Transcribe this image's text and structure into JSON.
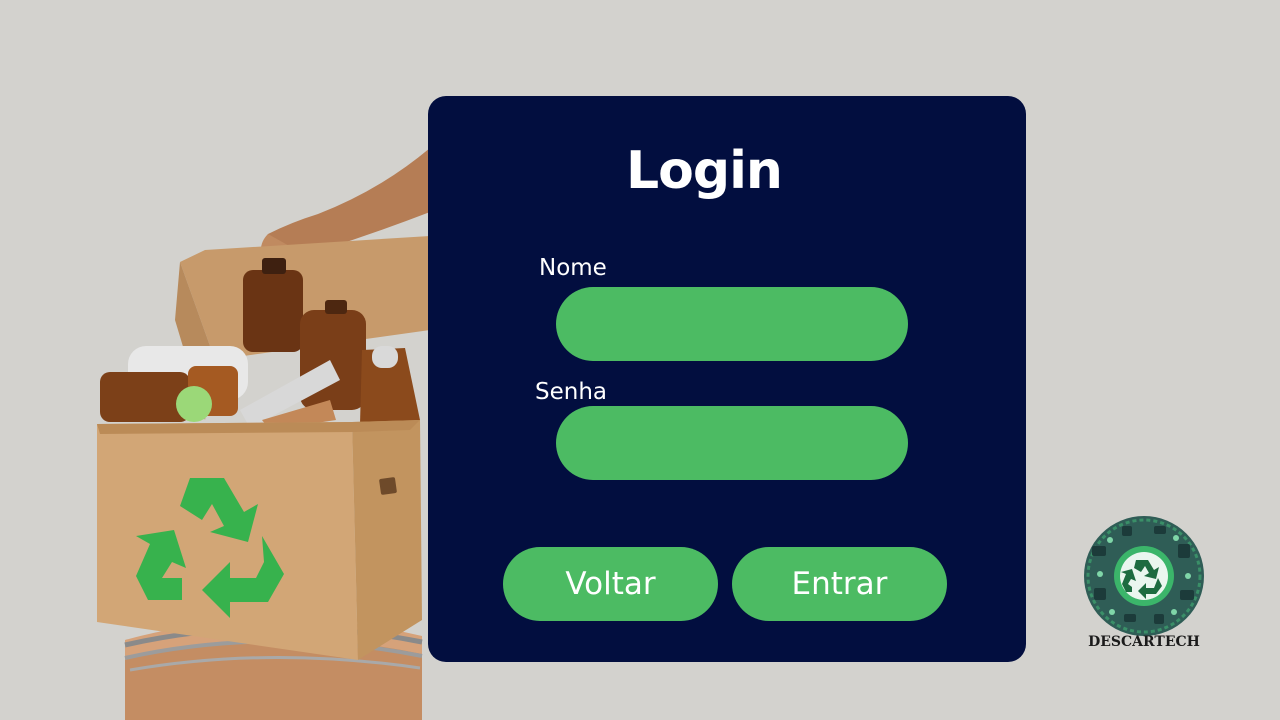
{
  "login": {
    "title": "Login",
    "name_label": "Nome",
    "name_value": "",
    "password_label": "Senha",
    "password_value": "",
    "back_button": "Voltar",
    "enter_button": "Entrar"
  },
  "logo": {
    "text": "DESCARTECH"
  },
  "colors": {
    "background": "#d3d2ce",
    "card": "#020e3f",
    "accent_green": "#4cbb63",
    "text": "#ffffff"
  }
}
